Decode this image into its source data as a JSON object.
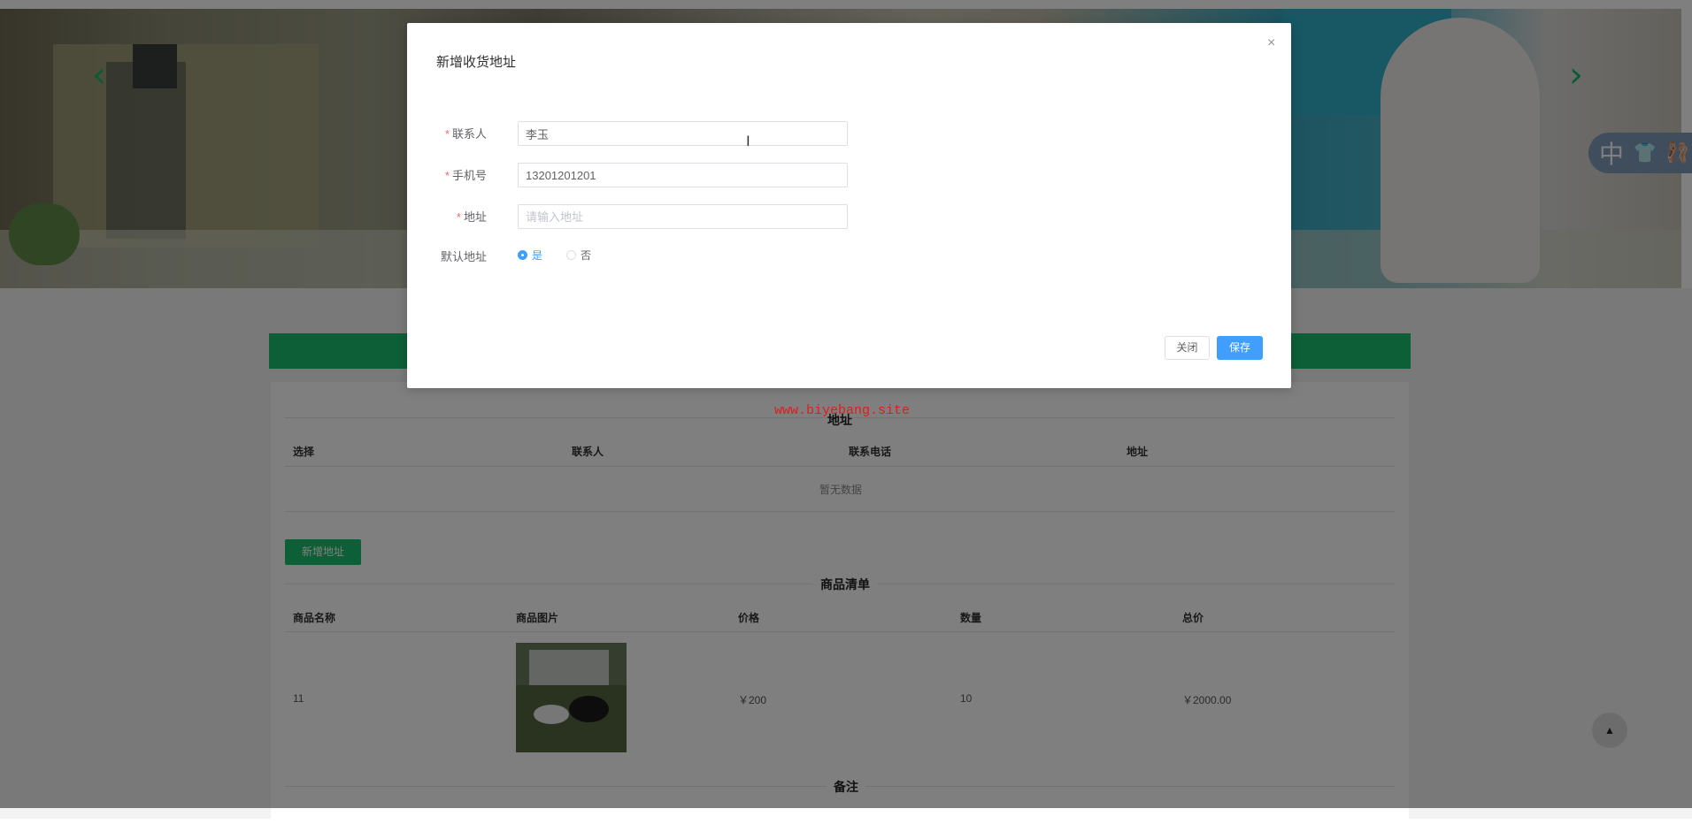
{
  "carousel": {
    "prev_icon": "chevron-left-icon",
    "next_icon": "chevron-right-icon",
    "prev_glyph": "‹",
    "next_glyph": "›"
  },
  "lang_widget": {
    "text": "中",
    "icons": [
      "shirt-icon",
      "ballet-icon"
    ],
    "shirt_glyph": "👕",
    "ballet_glyph": "🩰"
  },
  "address_section": {
    "title": "地址",
    "columns": [
      "选择",
      "联系人",
      "联系电话",
      "地址"
    ],
    "empty_text": "暂无数据",
    "add_button": "新增地址"
  },
  "goods_section": {
    "title": "商品清单",
    "columns": [
      "商品名称",
      "商品图片",
      "价格",
      "数量",
      "总价"
    ],
    "rows": [
      {
        "name": "11",
        "price": "￥200",
        "quantity": "10",
        "total": "￥2000.00"
      }
    ]
  },
  "remark_section": {
    "title": "备注"
  },
  "watermark": "www.biyebang.site",
  "back_to_top": "▲",
  "modal": {
    "title": "新增收货地址",
    "close_glyph": "×",
    "fields": {
      "contact": {
        "label": "联系人",
        "value": "李玉"
      },
      "phone": {
        "label": "手机号",
        "value": "13201201201"
      },
      "address": {
        "label": "地址",
        "value": "",
        "placeholder": "请输入地址"
      }
    },
    "default_address": {
      "label": "默认地址",
      "options": [
        "是",
        "否"
      ],
      "selected": "是"
    },
    "close_button": "关闭",
    "save_button": "保存"
  },
  "colors": {
    "accent_green": "#1bbf6e",
    "primary_blue": "#409eff",
    "required_red": "#f56c6c"
  }
}
